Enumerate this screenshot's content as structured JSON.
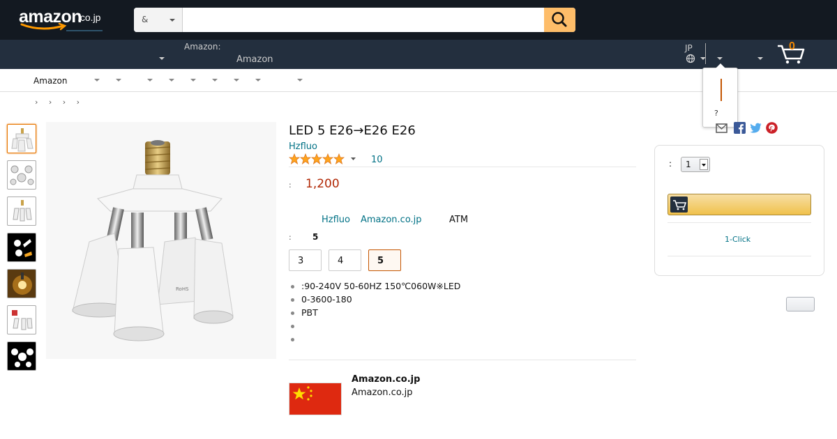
{
  "header": {
    "logo_word": "amazon",
    "logo_tld": ".co.jp",
    "search_category": "&",
    "search_placeholder": "",
    "deliver_line1": "",
    "account_line1": "Amazon:",
    "account_line2": "Amazon",
    "lang_code": "JP",
    "cart_count": "0"
  },
  "popover": {
    "question": "?"
  },
  "subnav": {
    "first_label": "Amazon"
  },
  "breadcrumb": "› › ›   ›",
  "product": {
    "title": "LED  5 E26→E26  E26",
    "brand": "Hzfluo",
    "rating_stars": 5,
    "rating_count": "10",
    "price_label": ":",
    "price": "1,200",
    "seller_brand": "Hzfluo",
    "seller_site": "Amazon.co.jp",
    "payment": "ATM",
    "variant_label": ":",
    "variant_value": "5",
    "options": [
      "3",
      "4",
      "5"
    ],
    "selected_option": "5",
    "bullets": [
      ":90-240V 50-60HZ 150℃060W※LED",
      "0-3600-180",
      "PBT",
      "",
      ""
    ],
    "seller_name": "Amazon.co.jp",
    "seller_sub": "Amazon.co.jp"
  },
  "buybox": {
    "qty_label": ":",
    "qty_value": "1",
    "oneclick": "1-Click"
  },
  "colors": {
    "nav_top": "#131921",
    "nav_bottom": "#232f3e",
    "accent": "#febd69",
    "price": "#b12704",
    "link": "#007185"
  }
}
